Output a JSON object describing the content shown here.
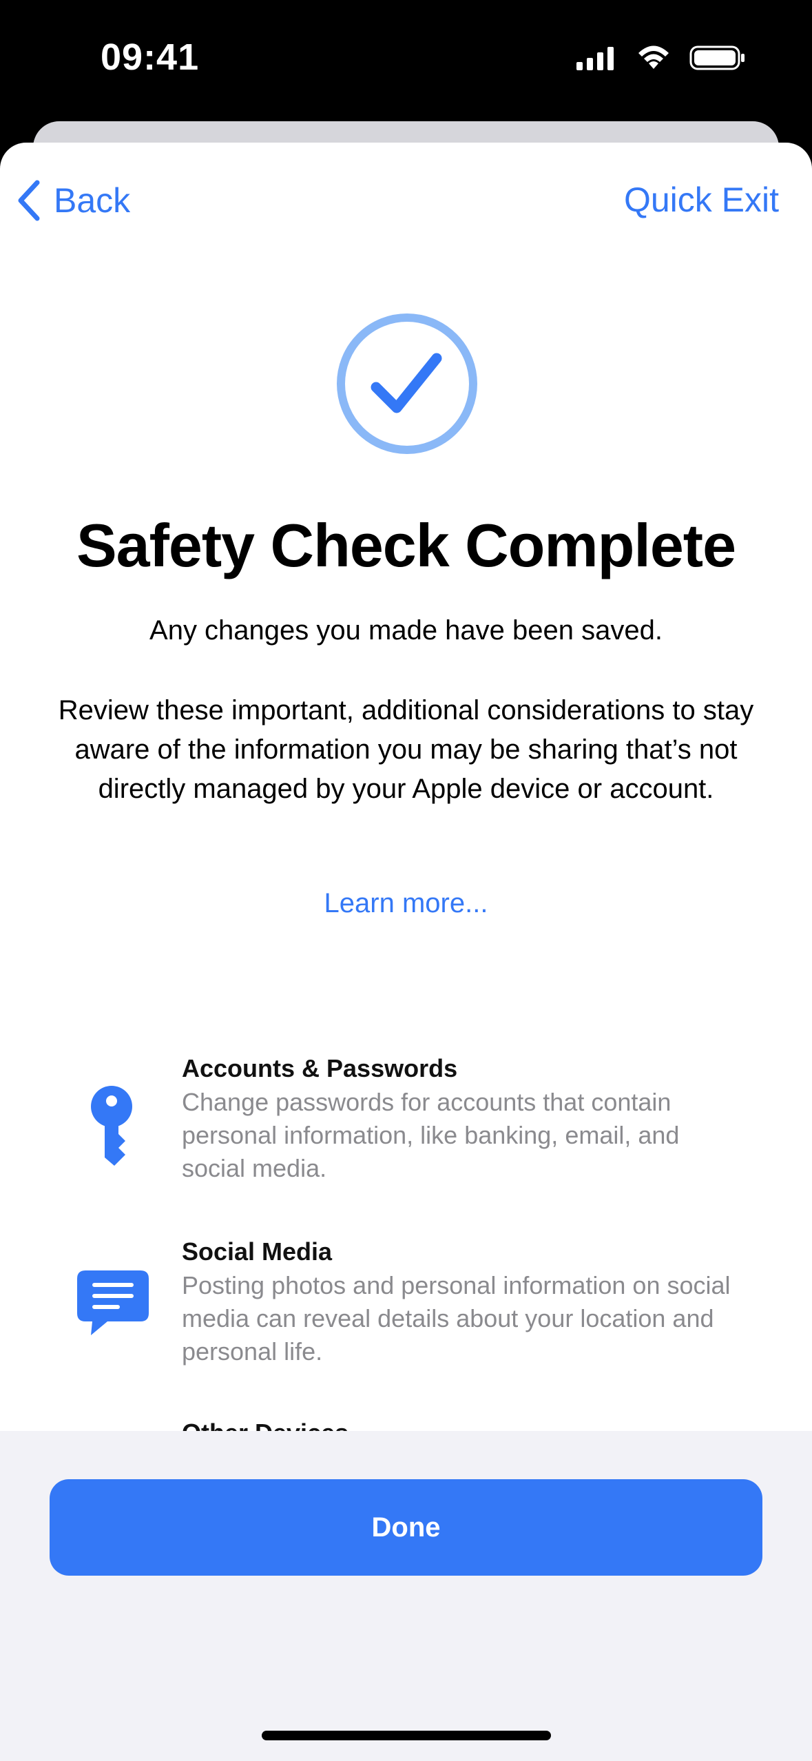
{
  "status_bar": {
    "time": "09:41",
    "icons": [
      "cellular-signal-icon",
      "wifi-icon",
      "battery-icon"
    ]
  },
  "nav": {
    "back_label": "Back",
    "quick_exit_label": "Quick Exit"
  },
  "hero": {
    "icon": "checkmark-circle-icon",
    "title": "Safety Check Complete",
    "subtitle": "Any changes you made have been saved.",
    "body": "Review these important, additional considerations to stay aware of the information you may be sharing that’s not directly managed by your Apple device or account.",
    "learn_more": "Learn more..."
  },
  "items": [
    {
      "icon": "key-icon",
      "title": "Accounts & Passwords",
      "description": "Change passwords for accounts that contain personal information, like banking, email, and social media."
    },
    {
      "icon": "message-bubble-icon",
      "title": "Social Media",
      "description": "Posting photos and personal information on social media can reveal details about your location and personal life."
    },
    {
      "title": "Other Devices"
    }
  ],
  "footer": {
    "done_label": "Done"
  },
  "colors": {
    "accent": "#3478f6",
    "badge_ring": "#8ab8f7",
    "secondary_text": "#8a8a8e",
    "tray_background": "#f2f2f7"
  }
}
